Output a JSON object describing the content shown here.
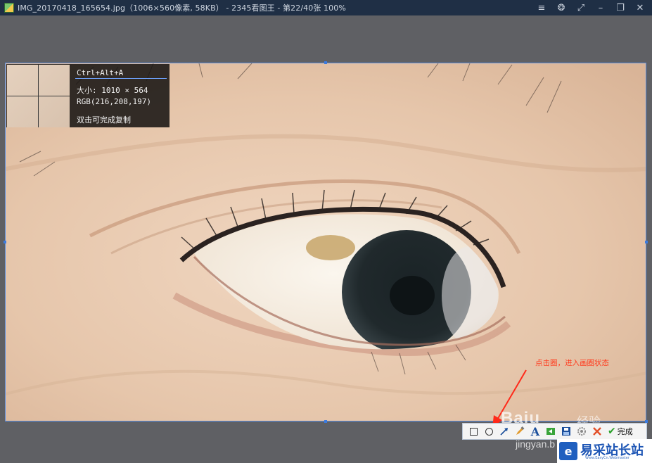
{
  "window": {
    "title": "IMG_20170418_165654.jpg（1006×560像素, 58KB） - 2345看图王 - 第22/40张 100%",
    "controls": [
      {
        "name": "menu-icon",
        "glyph": "≡"
      },
      {
        "name": "skin-icon",
        "glyph": "❂"
      },
      {
        "name": "fullscreen-icon",
        "glyph": "⤢"
      },
      {
        "name": "minimize-icon",
        "glyph": "–"
      },
      {
        "name": "restore-icon",
        "glyph": "❐"
      },
      {
        "name": "close-icon",
        "glyph": "✕"
      }
    ]
  },
  "info_panel": {
    "shortcut": "Ctrl+Alt+A",
    "size": "大小: 1010 × 564",
    "rgb": "RGB(216,208,197)",
    "hint": "双击可完成复制"
  },
  "annotation": {
    "text": "点击圈，进入画圈状态",
    "color": "#ff3b1e"
  },
  "toolbar": {
    "tools": [
      "rectangle-tool",
      "ellipse-tool",
      "arrow-tool",
      "brush-tool",
      "text-tool",
      "undo-tool",
      "save-tool",
      "settings-tool",
      "cancel-tool"
    ],
    "text_tool_glyph": "A",
    "done_label": "完成"
  },
  "watermarks": {
    "baidu": "Baiu",
    "baidu_cn": "经验",
    "jingyan": "jingyan.b"
  },
  "site_logo": {
    "name": "易采站长站",
    "url": "Www.EasyCn.Webmaster"
  },
  "colors": {
    "titlebar": "#1f2f45",
    "selection_border": "#5b8fe0",
    "annotation": "#ff3b1e",
    "logo_blue": "#1e56b5"
  }
}
